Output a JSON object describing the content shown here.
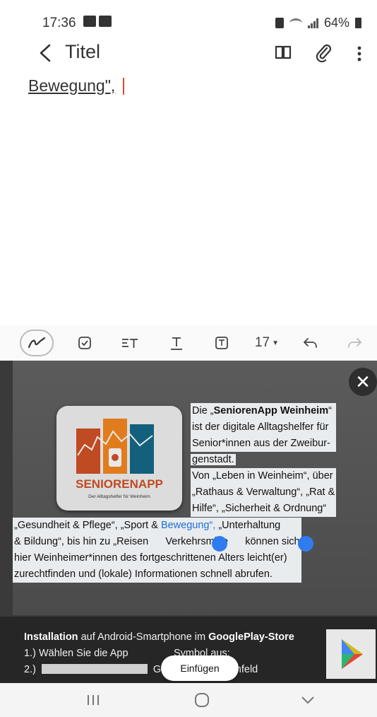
{
  "status_bar": {
    "time": "17:36",
    "battery": "64%",
    "icons": [
      "gallery-notification-icon",
      "message-notification-icon",
      "lock-icon",
      "wifi-icon",
      "signal-icon",
      "battery-icon"
    ]
  },
  "app_bar": {
    "title": "Titel",
    "icons": [
      "back-icon",
      "book-icon",
      "paperclip-icon",
      "more-icon"
    ]
  },
  "editor": {
    "text": "Bewegung\","
  },
  "toolbar": {
    "font_size": "17",
    "icons": [
      "pen-icon",
      "checkbox-icon",
      "text-style-icon",
      "underline-icon",
      "text-box-icon",
      "font-size-dropdown",
      "undo-icon",
      "redo-icon"
    ]
  },
  "clipboard_image": {
    "logo_text": "SENIORENAPP",
    "logo_subtitle": "Der Alltagshelfer für Weinheim",
    "para1": {
      "l1_a": "Die „",
      "l1_b": "SeniorenApp Weinheim",
      "l1_c": "“",
      "l2": "ist der digitale Alltagshelfer für",
      "l3": "Senior*innen aus der Zweibur-",
      "l4": "genstadt.",
      "l5": "Von „Leben in Weinheim“, über",
      "l6": "„Rathaus & Verwaltung“, „Rat &",
      "l7": "Hilfe“, „Sicherheit & Ordnung“"
    },
    "para2": {
      "l1_a": "„Gesundheit & Pflege“, „Sport & ",
      "l1_b": "Bewegung“,",
      "l1_c": " „Unterhaltung",
      "l2_a": "& Bildung“, bis hin zu „Reisen",
      "l2_b": "Verkehrsmitte",
      "l2_c": "können sich",
      "l3": "hier Weinheimer*innen des fortgeschrittenen Alters leicht(er)",
      "l4": "zurechtfinden und (lokale) Informationen schnell abrufen."
    },
    "install": {
      "l1_a": "Installation",
      "l1_b": " auf Android-Smartphone im ",
      "l1_c": "GooglePlay-Store",
      "l2_a": "1.) Wählen Sie die App",
      "l2_b": "Symbol aus:",
      "l3_a": "2.)",
      "l3_b": "Geben Sie im Suchfeld"
    }
  },
  "paste_button": "Einfügen",
  "nav_bar": {
    "icons": [
      "recent-apps-icon",
      "home-icon",
      "back-icon"
    ]
  },
  "colors": {
    "accent": "#e0462a",
    "selection_handle": "#2f7cf0",
    "highlight_text": "#1e6fd9"
  }
}
